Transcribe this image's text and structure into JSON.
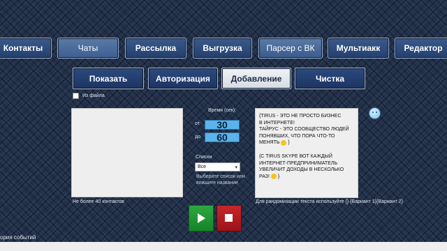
{
  "nav_tabs": [
    {
      "label": "Контакты"
    },
    {
      "label": "Чаты"
    },
    {
      "label": "Рассылка"
    },
    {
      "label": "Выгрузка"
    },
    {
      "label": "Парсер с ВК"
    },
    {
      "label": "Мультиакк"
    },
    {
      "label": "Редактор"
    }
  ],
  "sub_tabs": [
    {
      "label": "Показать"
    },
    {
      "label": "Авторизация"
    },
    {
      "label": "Добавление",
      "active": true
    },
    {
      "label": "Чистка"
    }
  ],
  "from_file_label": "Из файла",
  "contacts_limit_note": "Не более 40 контактов",
  "time": {
    "label": "Время (сек):",
    "from_label": "от",
    "from_value": "30",
    "to_label": "до",
    "to_value": "60"
  },
  "lists": {
    "label": "Списки",
    "selected": "Все",
    "hint": "Выберите список или впишите название"
  },
  "message": {
    "line1": "{TIRUS - это не просто бизнес",
    "line2": "в интернете!",
    "line3": "Тайрус - это сообщество людей",
    "line4": "понявших, что пора что-то",
    "line5": "менять",
    "line5_end": "}",
    "line6": "{С Tirus Skype вот каждый",
    "line7": "интернет-предприниматель",
    "line8": "увеличит доходы в несколько",
    "line9": "раз!",
    "line9_end": "}"
  },
  "randomize_note": "Для рандомизации текста используйте {}  {Вариант 1}{Вариант 2}",
  "event_log_label": "ория событий",
  "colors": {
    "tab_bg": "#2c4a7e",
    "time_field": "#5bb3ec",
    "play": "#2da840",
    "stop": "#c8262a"
  }
}
